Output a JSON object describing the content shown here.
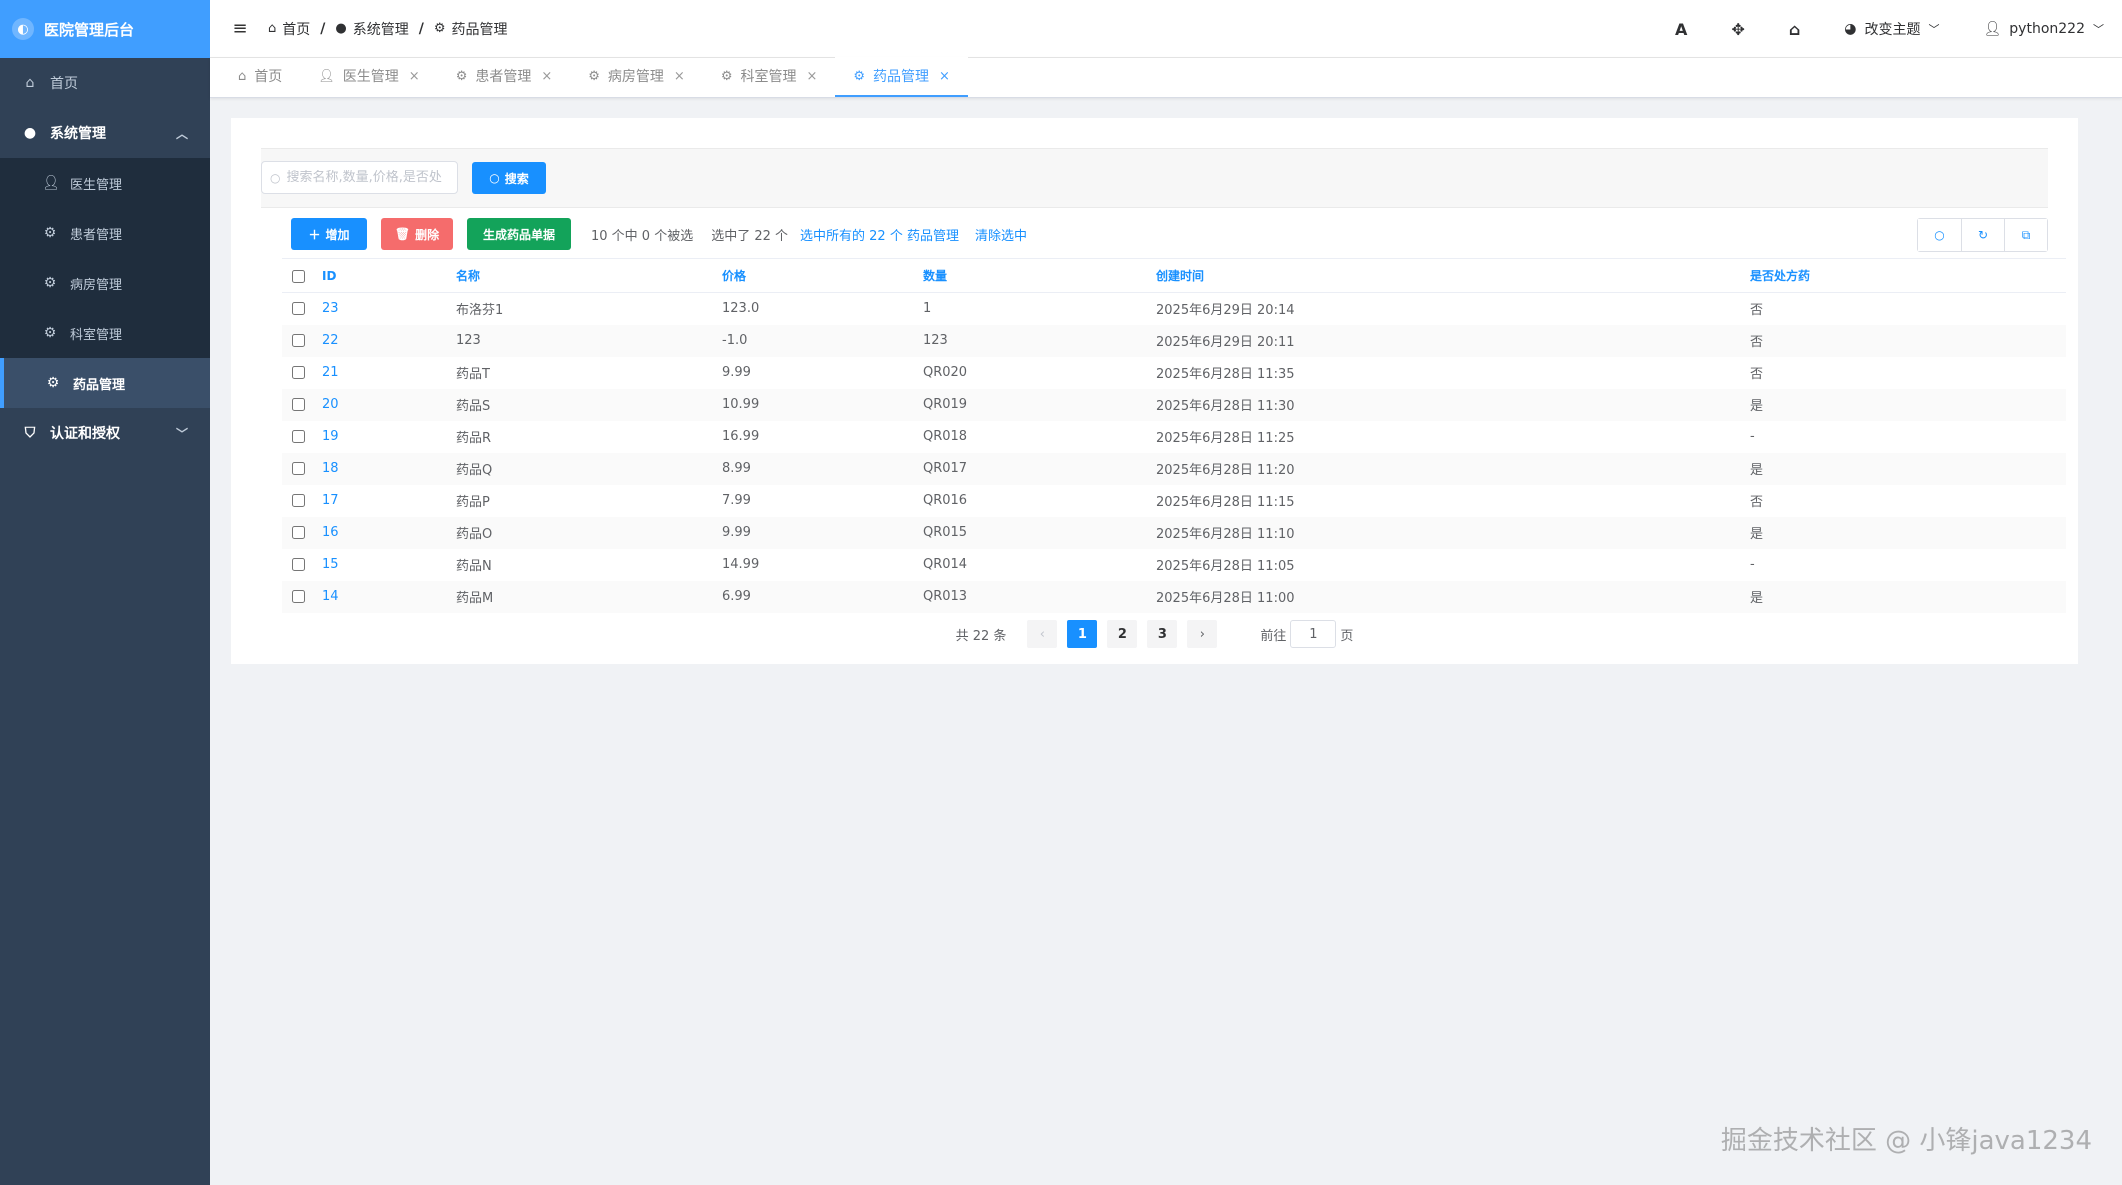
{
  "app": {
    "title": "医院管理后台",
    "logo_glyph": "◐"
  },
  "sidebar": {
    "home": {
      "label": "首页",
      "icon": "home-icon"
    },
    "system": {
      "label": "系统管理",
      "icon": "apple-icon",
      "expanded": true,
      "items": [
        {
          "label": "医生管理",
          "icon": "user-icon"
        },
        {
          "label": "患者管理",
          "icon": "gear-icon"
        },
        {
          "label": "病房管理",
          "icon": "gear-icon"
        },
        {
          "label": "科室管理",
          "icon": "gear-icon"
        },
        {
          "label": "药品管理",
          "icon": "gear-icon",
          "active": true
        }
      ]
    },
    "auth": {
      "label": "认证和授权",
      "icon": "shield-icon",
      "expanded": false
    }
  },
  "header": {
    "breadcrumb": [
      {
        "label": "首页",
        "icon": "home-icon"
      },
      {
        "label": "系统管理",
        "icon": "apple-icon"
      },
      {
        "label": "药品管理",
        "icon": "gear-icon"
      }
    ],
    "font_icon_glyph": "A",
    "theme_label": "改变主题",
    "username": "python222"
  },
  "tabs": [
    {
      "label": "首页",
      "icon": "home-icon",
      "closable": false,
      "active": false
    },
    {
      "label": "医生管理",
      "icon": "user-icon",
      "closable": true,
      "active": false
    },
    {
      "label": "患者管理",
      "icon": "gear-icon",
      "closable": true,
      "active": false
    },
    {
      "label": "病房管理",
      "icon": "gear-icon",
      "closable": true,
      "active": false
    },
    {
      "label": "科室管理",
      "icon": "gear-icon",
      "closable": true,
      "active": false
    },
    {
      "label": "药品管理",
      "icon": "gear-icon",
      "closable": true,
      "active": true
    }
  ],
  "search": {
    "placeholder": "搜索名称,数量,价格,是否处",
    "value": "",
    "button_label": "搜索"
  },
  "toolbar": {
    "add_label": "增加",
    "delete_label": "删除",
    "generate_label": "生成药品单据",
    "selection_info": "10 个中 0 个被选",
    "selected_count": "选中了 22 个",
    "select_all_link": "选中所有的 22 个 药品管理",
    "clear_link": "清除选中"
  },
  "table": {
    "columns": [
      "ID",
      "名称",
      "价格",
      "数量",
      "创建时间",
      "是否处方药"
    ],
    "rows": [
      {
        "id": "23",
        "name": "布洛芬1",
        "price": "123.0",
        "qty": "1",
        "created": "2025年6月29日 20:14",
        "rx": "否"
      },
      {
        "id": "22",
        "name": "123",
        "price": "-1.0",
        "qty": "123",
        "created": "2025年6月29日 20:11",
        "rx": "否"
      },
      {
        "id": "21",
        "name": "药品T",
        "price": "9.99",
        "qty": "QR020",
        "created": "2025年6月28日 11:35",
        "rx": "否"
      },
      {
        "id": "20",
        "name": "药品S",
        "price": "10.99",
        "qty": "QR019",
        "created": "2025年6月28日 11:30",
        "rx": "是"
      },
      {
        "id": "19",
        "name": "药品R",
        "price": "16.99",
        "qty": "QR018",
        "created": "2025年6月28日 11:25",
        "rx": "-"
      },
      {
        "id": "18",
        "name": "药品Q",
        "price": "8.99",
        "qty": "QR017",
        "created": "2025年6月28日 11:20",
        "rx": "是"
      },
      {
        "id": "17",
        "name": "药品P",
        "price": "7.99",
        "qty": "QR016",
        "created": "2025年6月28日 11:15",
        "rx": "否"
      },
      {
        "id": "16",
        "name": "药品O",
        "price": "9.99",
        "qty": "QR015",
        "created": "2025年6月28日 11:10",
        "rx": "是"
      },
      {
        "id": "15",
        "name": "药品N",
        "price": "14.99",
        "qty": "QR014",
        "created": "2025年6月28日 11:05",
        "rx": "-"
      },
      {
        "id": "14",
        "name": "药品M",
        "price": "6.99",
        "qty": "QR013",
        "created": "2025年6月28日 11:00",
        "rx": "是"
      }
    ]
  },
  "pagination": {
    "total_text": "共 22 条",
    "pages": [
      "1",
      "2",
      "3"
    ],
    "current_page": "1",
    "goto_label": "前往",
    "goto_value": "1",
    "page_suffix": "页"
  },
  "watermark": "掘金技术社区 @ 小锋java1234",
  "colors": {
    "sidebar_bg": "#304156",
    "logo_bg": "#409eff",
    "primary": "#1890ff",
    "danger": "#f56c6c",
    "success": "#13a35a"
  }
}
